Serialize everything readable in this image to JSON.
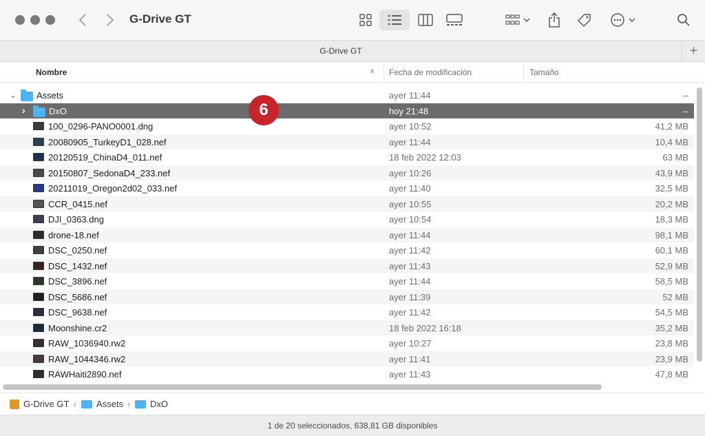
{
  "window": {
    "title": "G-Drive GT",
    "tab_title": "G-Drive GT",
    "tab_add": "+"
  },
  "toolbar": {
    "icons": [
      "icon-view-icon",
      "list-view-icon",
      "column-view-icon",
      "gallery-view-icon",
      "group-icon",
      "share-icon",
      "tag-icon",
      "more-icon",
      "search-icon"
    ],
    "active_view": "list-view"
  },
  "columns": {
    "name": "Nombre",
    "date": "Fecha de modificación",
    "size": "Tamaño"
  },
  "files": [
    {
      "name": "Assets",
      "date": "ayer 11:44",
      "size": "--",
      "kind": "folder"
    },
    {
      "name": "DxO",
      "date": "hoy 21:48",
      "size": "--",
      "kind": "folder"
    },
    {
      "name": "100_0296-PANO0001.dng",
      "date": "ayer 10:52",
      "size": "41,2 MB",
      "kind": "image"
    },
    {
      "name": "20080905_TurkeyD1_028.nef",
      "date": "ayer 11:44",
      "size": "10,4 MB",
      "kind": "image"
    },
    {
      "name": "20120519_ChinaD4_011.nef",
      "date": "18 feb 2022 12:03",
      "size": "63 MB",
      "kind": "image"
    },
    {
      "name": "20150807_SedonaD4_233.nef",
      "date": "ayer 10:26",
      "size": "43,9 MB",
      "kind": "image"
    },
    {
      "name": "20211019_Oregon2d02_033.nef",
      "date": "ayer 11:40",
      "size": "32,5 MB",
      "kind": "image"
    },
    {
      "name": "CCR_0415.nef",
      "date": "ayer 10:55",
      "size": "20,2 MB",
      "kind": "image"
    },
    {
      "name": "DJI_0363.dng",
      "date": "ayer 10:54",
      "size": "18,3 MB",
      "kind": "image"
    },
    {
      "name": "drone-18.nef",
      "date": "ayer 11:44",
      "size": "98,1 MB",
      "kind": "image"
    },
    {
      "name": "DSC_0250.nef",
      "date": "ayer 11:42",
      "size": "60,1 MB",
      "kind": "image"
    },
    {
      "name": "DSC_1432.nef",
      "date": "ayer 11:43",
      "size": "52,9 MB",
      "kind": "image"
    },
    {
      "name": "DSC_3896.nef",
      "date": "ayer 11:44",
      "size": "58,5 MB",
      "kind": "image"
    },
    {
      "name": "DSC_5686.nef",
      "date": "ayer 11:39",
      "size": "52 MB",
      "kind": "image"
    },
    {
      "name": "DSC_9638.nef",
      "date": "ayer 11:42",
      "size": "54,5 MB",
      "kind": "image"
    },
    {
      "name": "Moonshine.cr2",
      "date": "18 feb 2022 16:18",
      "size": "35,2 MB",
      "kind": "image"
    },
    {
      "name": "RAW_1036940.rw2",
      "date": "ayer 10:27",
      "size": "23,8 MB",
      "kind": "image"
    },
    {
      "name": "RAW_1044346.rw2",
      "date": "ayer 11:41",
      "size": "23,9 MB",
      "kind": "image"
    },
    {
      "name": "RAWHaiti2890.nef",
      "date": "ayer 11:43",
      "size": "47,8 MB",
      "kind": "image"
    }
  ],
  "badge": "6",
  "path": {
    "items": [
      "G-Drive GT",
      "Assets",
      "DxO"
    ]
  },
  "status": "1 de 20 seleccionados, 638,81 GB disponibles",
  "colors": {
    "selection": "#6b6b6b",
    "folder": "#4eb3f1",
    "badge": "#c8242b"
  }
}
